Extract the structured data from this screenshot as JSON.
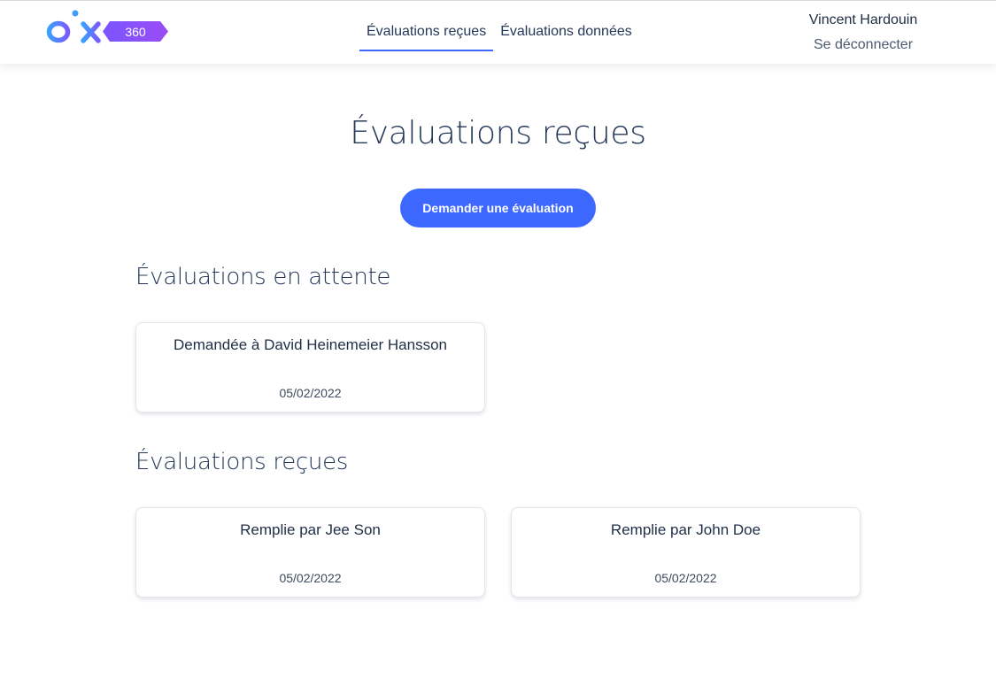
{
  "header": {
    "logo_text": "pix",
    "logo_badge": "360",
    "nav": [
      {
        "label": "Évaluations reçues",
        "active": true
      },
      {
        "label": "Évaluations données",
        "active": false
      }
    ],
    "user_name": "Vincent Hardouin",
    "logout_label": "Se déconnecter"
  },
  "main": {
    "title": "Évaluations reçues",
    "request_button_label": "Demander une évaluation",
    "pending": {
      "title": "Évaluations en attente",
      "cards": [
        {
          "title": "Demandée à David Heinemeier Hansson",
          "date": "05/02/2022"
        }
      ]
    },
    "received": {
      "title": "Évaluations reçues",
      "cards": [
        {
          "title": "Remplie par Jee Son",
          "date": "05/02/2022"
        },
        {
          "title": "Remplie par John Doe",
          "date": "05/02/2022"
        }
      ]
    }
  },
  "colors": {
    "accent": "#3d68ff",
    "text": "#253858",
    "logo_gradient_start": "#3d9bff",
    "logo_gradient_end": "#8a4dff"
  }
}
